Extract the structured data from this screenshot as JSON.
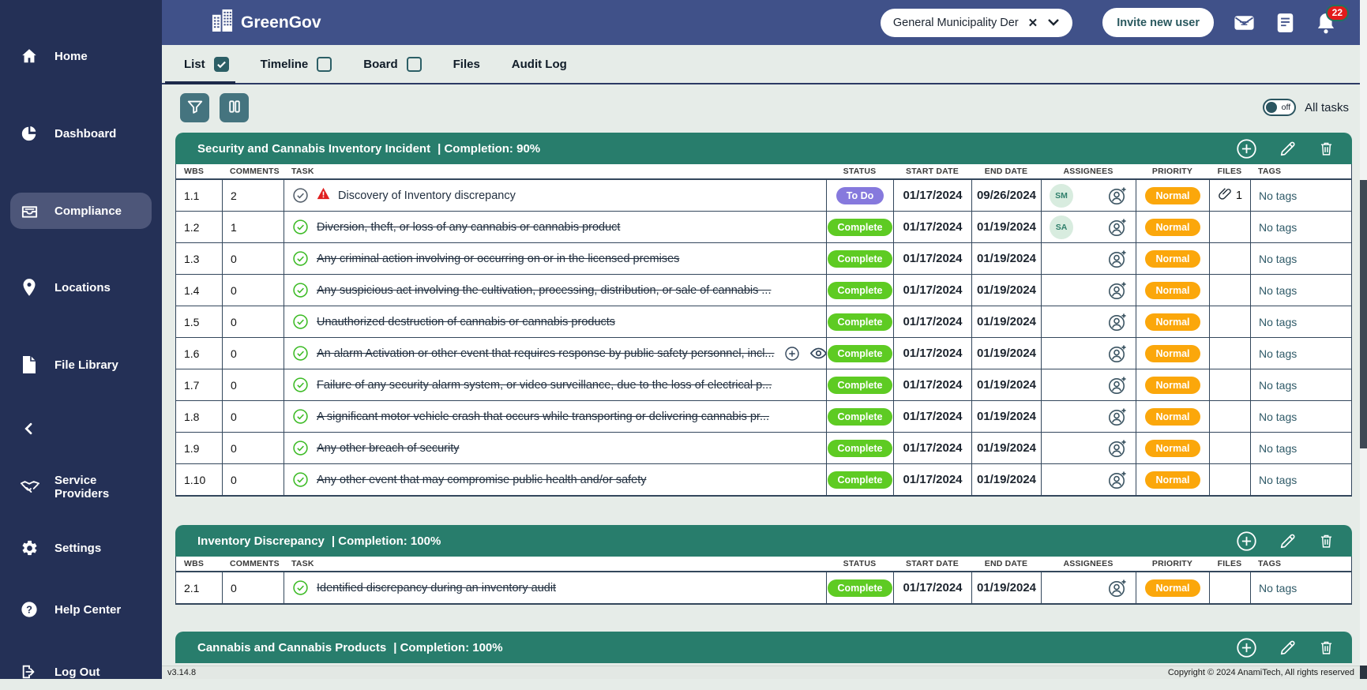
{
  "app": {
    "name": "GreenGov",
    "version": "v3.14.8",
    "copyright": "Copyright © 2024 AnamiTech, All rights reserved"
  },
  "header": {
    "org_selector": {
      "value": "General Municipality Der",
      "clear_icon": "x-icon",
      "chevron_icon": "chevron-down-icon"
    },
    "invite_button": "Invite new user",
    "icons": [
      "mail-icon",
      "notes-icon",
      "bell-icon"
    ],
    "notifications": {
      "count": "22"
    }
  },
  "sidebar": {
    "items": [
      {
        "label": "Home",
        "icon": "home-icon"
      },
      {
        "label": "Dashboard",
        "icon": "dashboard-icon"
      },
      {
        "label": "Compliance",
        "icon": "compliance-icon",
        "active": true
      },
      {
        "label": "Locations",
        "icon": "location-pin-icon"
      },
      {
        "label": "File Library",
        "icon": "file-icon"
      },
      {
        "collapse": true,
        "icon": "chevron-left-icon"
      },
      {
        "label": "Service Providers",
        "icon": "handshake-icon"
      },
      {
        "label": "Settings",
        "icon": "gear-icon"
      },
      {
        "label": "Help Center",
        "icon": "help-icon"
      },
      {
        "label": "Log Out",
        "icon": "logout-icon"
      }
    ]
  },
  "tabs": [
    {
      "label": "List",
      "checkbox": true,
      "checked": true,
      "active": true
    },
    {
      "label": "Timeline",
      "checkbox": true,
      "checked": false
    },
    {
      "label": "Board",
      "checkbox": true,
      "checked": false
    },
    {
      "label": "Files",
      "checkbox": false
    },
    {
      "label": "Audit Log",
      "checkbox": false
    }
  ],
  "toolbar": {
    "buttons": [
      {
        "icon": "filter-icon"
      },
      {
        "icon": "columns-icon"
      }
    ],
    "toggle": {
      "state": "off",
      "label": "All tasks"
    }
  },
  "table": {
    "columns": [
      "WBS",
      "COMMENTS",
      "TASK",
      "STATUS",
      "START DATE",
      "END DATE",
      "ASSIGNEES",
      "PRIORITY",
      "FILES",
      "TAGS"
    ]
  },
  "sections": [
    {
      "title": "Security and Cannabis Inventory Incident",
      "completion": "| Completion: 90%",
      "rows": [
        {
          "wbs": "1.1",
          "comments": "2",
          "task": "Discovery of Inventory discrepancy",
          "done": false,
          "warning": true,
          "status": "To Do",
          "status_type": "todo",
          "start": "01/17/2024",
          "end": "09/26/2024",
          "assignee": "SM",
          "priority": "Normal",
          "files": "1",
          "tags": "No tags"
        },
        {
          "wbs": "1.2",
          "comments": "1",
          "task": "Diversion, theft, or loss of any cannabis or cannabis product",
          "done": true,
          "status": "Complete",
          "status_type": "complete",
          "start": "01/17/2024",
          "end": "01/19/2024",
          "assignee": "SA",
          "priority": "Normal",
          "files": "",
          "tags": "No tags"
        },
        {
          "wbs": "1.3",
          "comments": "0",
          "task": "Any criminal action involving or occurring on or in the licensed premises",
          "done": true,
          "status": "Complete",
          "status_type": "complete",
          "start": "01/17/2024",
          "end": "01/19/2024",
          "assignee": "",
          "priority": "Normal",
          "files": "",
          "tags": "No tags"
        },
        {
          "wbs": "1.4",
          "comments": "0",
          "task": "Any suspicious act involving the cultivation, processing, distribution, or sale of cannabis ...",
          "done": true,
          "status": "Complete",
          "status_type": "complete",
          "start": "01/17/2024",
          "end": "01/19/2024",
          "assignee": "",
          "priority": "Normal",
          "files": "",
          "tags": "No tags"
        },
        {
          "wbs": "1.5",
          "comments": "0",
          "task": "Unauthorized destruction of cannabis or cannabis products",
          "done": true,
          "status": "Complete",
          "status_type": "complete",
          "start": "01/17/2024",
          "end": "01/19/2024",
          "assignee": "",
          "priority": "Normal",
          "files": "",
          "tags": "No tags"
        },
        {
          "wbs": "1.6",
          "comments": "0",
          "task": "An alarm Activation or other event that requires response by public safety personnel, incl...",
          "done": true,
          "row_actions": true,
          "status": "Complete",
          "status_type": "complete",
          "start": "01/17/2024",
          "end": "01/19/2024",
          "assignee": "",
          "priority": "Normal",
          "files": "",
          "tags": "No tags"
        },
        {
          "wbs": "1.7",
          "comments": "0",
          "task": "Failure of any security alarm system, or video surveillance, due to the loss of electrical p...",
          "done": true,
          "status": "Complete",
          "status_type": "complete",
          "start": "01/17/2024",
          "end": "01/19/2024",
          "assignee": "",
          "priority": "Normal",
          "files": "",
          "tags": "No tags"
        },
        {
          "wbs": "1.8",
          "comments": "0",
          "task": "A significant motor vehicle crash that occurs while transporting or delivering cannabis pr...",
          "done": true,
          "status": "Complete",
          "status_type": "complete",
          "start": "01/17/2024",
          "end": "01/19/2024",
          "assignee": "",
          "priority": "Normal",
          "files": "",
          "tags": "No tags"
        },
        {
          "wbs": "1.9",
          "comments": "0",
          "task": "Any other breach of security",
          "done": true,
          "status": "Complete",
          "status_type": "complete",
          "start": "01/17/2024",
          "end": "01/19/2024",
          "assignee": "",
          "priority": "Normal",
          "files": "",
          "tags": "No tags"
        },
        {
          "wbs": "1.10",
          "comments": "0",
          "task": "Any other event that may compromise public health and/or safety",
          "done": true,
          "status": "Complete",
          "status_type": "complete",
          "start": "01/17/2024",
          "end": "01/19/2024",
          "assignee": "",
          "priority": "Normal",
          "files": "",
          "tags": "No tags"
        }
      ]
    },
    {
      "title": "Inventory Discrepancy",
      "completion": "| Completion: 100%",
      "rows": [
        {
          "wbs": "2.1",
          "comments": "0",
          "task": "Identified discrepancy during an inventory audit",
          "done": true,
          "status": "Complete",
          "status_type": "complete",
          "start": "01/17/2024",
          "end": "01/19/2024",
          "assignee": "",
          "priority": "Normal",
          "files": "",
          "tags": "No tags"
        }
      ]
    },
    {
      "title": "Cannabis and Cannabis Products",
      "completion": "| Completion: 100%",
      "rows": []
    }
  ],
  "colors": {
    "sidebar_navy": "#243056",
    "header_blue": "#405189",
    "section_teal": "#287d6c",
    "tool_teal": "#45747f",
    "status_todo": "#8679dd",
    "status_complete": "#5ecb23",
    "priority_normal": "#fba70b",
    "badge_red": "#e21b1b",
    "content_bg": "#e6ece8"
  }
}
